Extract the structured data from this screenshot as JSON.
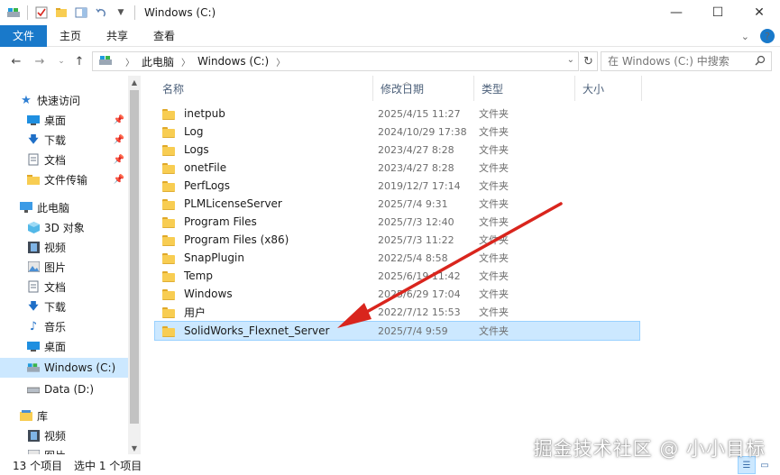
{
  "window": {
    "title": "Windows (C:)",
    "controls": {
      "minimize": "—",
      "maximize": "☐",
      "close": "✕"
    }
  },
  "ribbon": {
    "tabs": [
      "文件",
      "主页",
      "共享",
      "查看"
    ],
    "expand": "⌄",
    "help": "?"
  },
  "address": {
    "crumbs": [
      "此电脑",
      "Windows (C:)"
    ],
    "search_placeholder": "在 Windows (C:) 中搜索"
  },
  "nav": {
    "quick_access": "快速访问",
    "quick_items": [
      {
        "label": "桌面",
        "icon": "desktop-icon"
      },
      {
        "label": "下载",
        "icon": "download-icon"
      },
      {
        "label": "文档",
        "icon": "document-icon"
      },
      {
        "label": "文件传输",
        "icon": "folder-icon"
      }
    ],
    "this_pc": "此电脑",
    "pc_items": [
      {
        "label": "3D 对象",
        "icon": "3d-objects-icon"
      },
      {
        "label": "视频",
        "icon": "video-icon"
      },
      {
        "label": "图片",
        "icon": "pictures-icon"
      },
      {
        "label": "文档",
        "icon": "document-icon"
      },
      {
        "label": "下载",
        "icon": "download-icon"
      },
      {
        "label": "音乐",
        "icon": "music-icon"
      },
      {
        "label": "桌面",
        "icon": "desktop-icon"
      },
      {
        "label": "Windows (C:)",
        "icon": "drive-c-icon"
      },
      {
        "label": "Data (D:)",
        "icon": "drive-d-icon"
      }
    ],
    "library": "库",
    "library_items": [
      {
        "label": "视频",
        "icon": "video-icon"
      },
      {
        "label": "图片",
        "icon": "pictures-icon"
      }
    ]
  },
  "columns": {
    "name": "名称",
    "modified": "修改日期",
    "type": "类型",
    "size": "大小"
  },
  "files": [
    {
      "name": "inetpub",
      "date": "2025/4/15 11:27",
      "type": "文件夹"
    },
    {
      "name": "Log",
      "date": "2024/10/29 17:38",
      "type": "文件夹"
    },
    {
      "name": "Logs",
      "date": "2023/4/27 8:28",
      "type": "文件夹"
    },
    {
      "name": "onetFile",
      "date": "2023/4/27 8:28",
      "type": "文件夹"
    },
    {
      "name": "PerfLogs",
      "date": "2019/12/7 17:14",
      "type": "文件夹"
    },
    {
      "name": "PLMLicenseServer",
      "date": "2025/7/4 9:31",
      "type": "文件夹"
    },
    {
      "name": "Program Files",
      "date": "2025/7/3 12:40",
      "type": "文件夹"
    },
    {
      "name": "Program Files (x86)",
      "date": "2025/7/3 11:22",
      "type": "文件夹"
    },
    {
      "name": "SnapPlugin",
      "date": "2022/5/4 8:58",
      "type": "文件夹"
    },
    {
      "name": "Temp",
      "date": "2025/6/19 11:42",
      "type": "文件夹"
    },
    {
      "name": "Windows",
      "date": "2025/6/29 17:04",
      "type": "文件夹"
    },
    {
      "name": "用户",
      "date": "2022/7/12 15:53",
      "type": "文件夹"
    },
    {
      "name": "SolidWorks_Flexnet_Server",
      "date": "2025/7/4 9:59",
      "type": "文件夹"
    }
  ],
  "status": {
    "count": "13 个项目",
    "selected": "选中 1 个项目"
  },
  "watermark": "掘金技术社区 @ 小小目标",
  "colors": {
    "accent": "#1979ca",
    "selection": "#cce8ff",
    "arrow": "#d9251d",
    "folder": "#f8cd52"
  }
}
